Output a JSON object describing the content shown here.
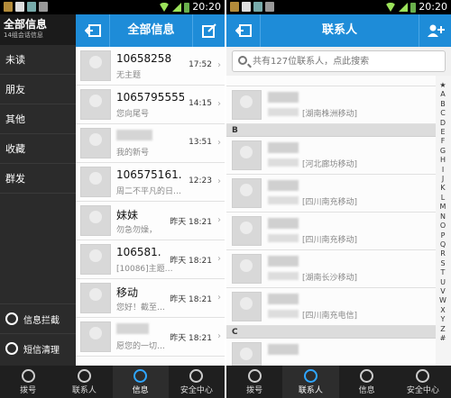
{
  "status": {
    "time": "20:20"
  },
  "left": {
    "side": {
      "title": "全部信息",
      "subtitle": "14组会话信息",
      "items": [
        "未读",
        "朋友",
        "其他",
        "收藏",
        "群发"
      ],
      "tools": [
        {
          "label": "信息拦截",
          "icon": "block-icon"
        },
        {
          "label": "短信清理",
          "icon": "clean-icon"
        }
      ]
    },
    "header": {
      "title": "全部信息"
    },
    "messages": [
      {
        "name": "10658258",
        "preview": "无主题",
        "time": "17:52"
      },
      {
        "name": "1065795555",
        "preview": "您向尾号",
        "time": "14:15"
      },
      {
        "name": "",
        "preview": "我的新号",
        "time": "13:51"
      },
      {
        "name": "106575161.",
        "preview": "周二不平凡的日…",
        "time": "12:23"
      },
      {
        "name": "妹妹",
        "preview": "勿急勿燥，",
        "time": "昨天 18:21"
      },
      {
        "name": "106581.",
        "preview": "[10086]主题…",
        "time": "昨天 18:21"
      },
      {
        "name": "移动",
        "preview": "您好！截至…",
        "time": "昨天 18:21"
      },
      {
        "name": "",
        "preview": "愿您的一切…",
        "time": "昨天 18:21"
      }
    ]
  },
  "right": {
    "header": {
      "title": "联系人"
    },
    "search": {
      "placeholder": "共有127位联系人，点此搜索"
    },
    "top_partial_location": "[湖南株洲移动]",
    "groups": [
      {
        "letter": "",
        "contacts": [
          {
            "location": "[湖南株洲移动]"
          }
        ]
      },
      {
        "letter": "B",
        "contacts": [
          {
            "location": "[河北廊坊移动]"
          },
          {
            "location": "[四川南充移动]"
          },
          {
            "location": "[四川南充移动]"
          },
          {
            "location": "[湖南长沙移动]"
          },
          {
            "location": "[四川南充电信]"
          }
        ]
      },
      {
        "letter": "C",
        "contacts": []
      }
    ],
    "alpha": [
      "★",
      "A",
      "B",
      "C",
      "D",
      "E",
      "F",
      "G",
      "H",
      "I",
      "J",
      "K",
      "L",
      "M",
      "N",
      "O",
      "P",
      "Q",
      "R",
      "S",
      "T",
      "U",
      "V",
      "W",
      "X",
      "Y",
      "Z",
      "#"
    ]
  },
  "tabs": [
    {
      "label": "拨号",
      "icon": "phone-icon"
    },
    {
      "label": "联系人",
      "icon": "contacts-icon"
    },
    {
      "label": "信息",
      "icon": "message-icon"
    },
    {
      "label": "安全中心",
      "icon": "security-icon"
    }
  ],
  "colors": {
    "accent": "#1e8cd8",
    "menu_bg": "#2b2b2b",
    "tabbar_bg": "#1f1f1f"
  }
}
